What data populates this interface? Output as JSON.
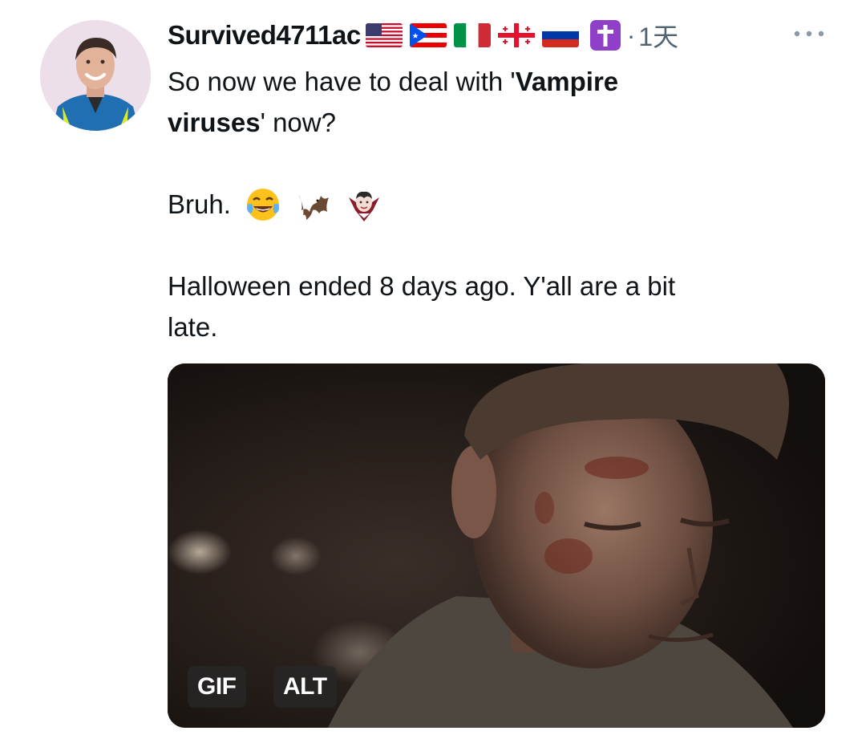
{
  "tweet": {
    "username": "Survived4711ac",
    "timestamp_separator": "·",
    "timestamp": "1天",
    "flags": [
      "us-flag-icon",
      "puerto-rico-flag-icon",
      "italy-flag-icon",
      "georgia-flag-icon",
      "russia-flag-icon"
    ],
    "badge_icon": "latin-cross-icon",
    "text": {
      "line1_plain": "So now we have to deal with '",
      "line1_bold": "Vampire",
      "line2_bold": "viruses",
      "line2_plain": "' now?",
      "para2": "Bruh.",
      "para2_emojis": [
        "tears-of-joy-icon",
        "bat-icon",
        "vampire-icon"
      ],
      "para3_line1": "Halloween ended 8 days ago. Y'all are a bit",
      "para3_line2": "late."
    },
    "media": {
      "gif_label": "GIF",
      "alt_label": "ALT"
    }
  },
  "colors": {
    "text": "#0f1419",
    "secondary": "#536471",
    "badge_bg": "#282828"
  }
}
